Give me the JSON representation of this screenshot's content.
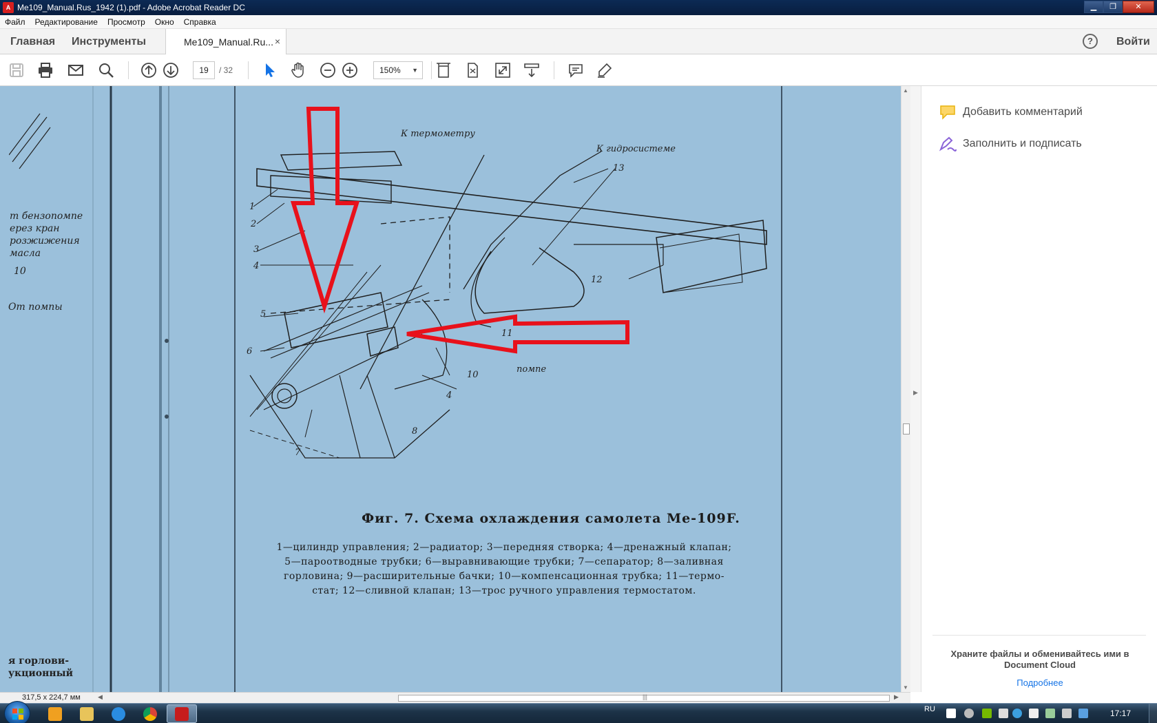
{
  "window": {
    "title": "Me109_Manual.Rus_1942 (1).pdf - Adobe Acrobat Reader DC",
    "minimize": "▁",
    "maximize": "❐",
    "close": "✕"
  },
  "menu": {
    "items": [
      "Файл",
      "Редактирование",
      "Просмотр",
      "Окно",
      "Справка"
    ]
  },
  "tabs": {
    "home": "Главная",
    "tools": "Инструменты",
    "document": "Me109_Manual.Ru...",
    "close": "×",
    "help": "?",
    "login": "Войти"
  },
  "toolbar": {
    "page_current": "19",
    "page_total": "/ 32",
    "zoom": "150%",
    "zoom_dropdown": "▼"
  },
  "document": {
    "figure_caption": "Фиг. 7. Схема охлаждения самолета Ме-109F.",
    "legend_lines": [
      "1—цилиндр управления; 2—радиатор; 3—передняя створка; 4—дренажный клапан;",
      "5—пароотводные трубки; 6—выравнивающие трубки; 7—сепаратор; 8—заливная",
      "горловина; 9—расширительные бачки; 10—компенсационная трубка; 11—термо-",
      "стат; 12—сливной клапан; 13—трос ручного управления термостатом."
    ],
    "margin_left_top": [
      "т бензопомпе",
      "ерез кран",
      "розжижения",
      "масла"
    ],
    "margin_left_10": "10",
    "margin_left_pump": "От помпы",
    "margin_left_bottom": [
      "я горлови-",
      "укционный"
    ],
    "callouts": {
      "thermometer": "К термометру",
      "hydro": "К гидросистеме",
      "pump_small": "помпе",
      "n1": "1",
      "n2": "2",
      "n3": "3",
      "n4a": "4",
      "n4b": "4",
      "n5": "5",
      "n6": "6",
      "n7": "7",
      "n8": "8",
      "n10": "10",
      "n11": "11",
      "n12": "12",
      "n13": "13"
    }
  },
  "right_pane": {
    "add_comment": "Добавить комментарий",
    "fill_sign": "Заполнить и подписать",
    "cloud_text": "Храните файлы и обменивайтесь ими в Document Cloud",
    "cloud_link": "Подробнее"
  },
  "status": {
    "page_dims": "317,5 x 224,7 мм"
  },
  "taskbar": {
    "lang": "RU",
    "clock": "17:17"
  },
  "colors": {
    "page_background": "#9bc0db",
    "annotation_red": "#e8111b",
    "link_blue": "#1473e6"
  }
}
